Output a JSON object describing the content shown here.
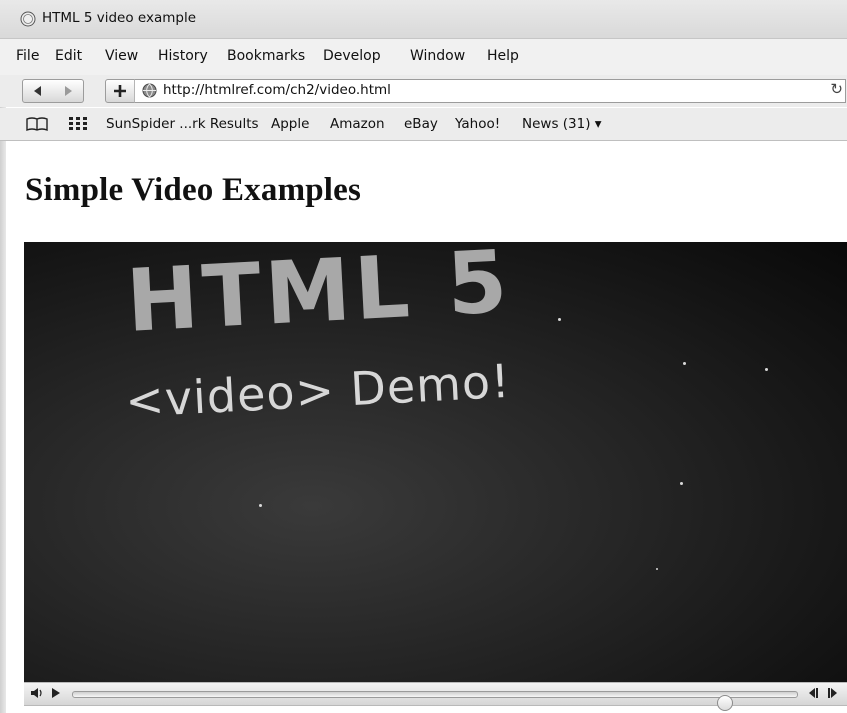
{
  "window": {
    "title": "HTML 5 video example",
    "app_icon": "safari-icon"
  },
  "menubar": {
    "items": [
      "File",
      "Edit",
      "View",
      "History",
      "Bookmarks",
      "Develop",
      "Window",
      "Help"
    ]
  },
  "navbar": {
    "back_icon": "back-arrow-icon",
    "forward_icon": "forward-arrow-icon",
    "add_icon": "plus-icon",
    "url": "http://htmlref.com/ch2/video.html",
    "reload_icon": "reload-icon"
  },
  "bookmarks": {
    "items": [
      "SunSpider ...rk Results",
      "Apple",
      "Amazon",
      "eBay",
      "Yahoo!",
      "News (31) ▾"
    ]
  },
  "page": {
    "heading": "Simple Video Examples"
  },
  "video": {
    "title_line1": "HTML 5",
    "title_line2": "<video> Demo!",
    "playback_progress": 0.9,
    "controls": {
      "volume_icon": "volume-icon",
      "play_icon": "play-icon",
      "rewind_icon": "rewind-icon",
      "forward_icon": "step-forward-icon"
    }
  }
}
